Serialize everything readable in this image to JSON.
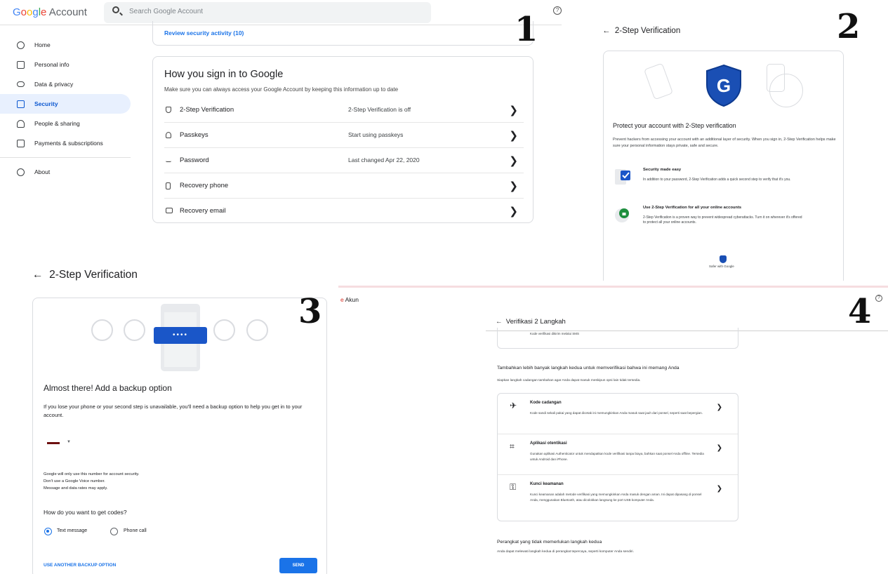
{
  "panel1": {
    "logo_google": "Google",
    "logo_account": "Account",
    "search_placeholder": "Search Google Account",
    "nav": [
      {
        "label": "Home",
        "icon": "home-icon"
      },
      {
        "label": "Personal info",
        "icon": "id-card-icon"
      },
      {
        "label": "Data & privacy",
        "icon": "toggle-icon"
      },
      {
        "label": "Security",
        "icon": "lock-icon",
        "active": true
      },
      {
        "label": "People & sharing",
        "icon": "people-icon"
      },
      {
        "label": "Payments & subscriptions",
        "icon": "card-icon"
      },
      {
        "label": "About",
        "icon": "info-icon"
      }
    ],
    "review_link": "Review security activity (10)",
    "signin_title": "How you sign in to Google",
    "signin_subtitle": "Make sure you can always access your Google Account by keeping this information up to date",
    "rows": [
      {
        "label": "2-Step Verification",
        "value": "2-Step Verification is off"
      },
      {
        "label": "Passkeys",
        "value": "Start using passkeys"
      },
      {
        "label": "Password",
        "value": "Last changed Apr 22, 2020"
      },
      {
        "label": "Recovery phone",
        "value": ""
      },
      {
        "label": "Recovery email",
        "value": ""
      }
    ],
    "number": "1"
  },
  "panel2": {
    "title": "2-Step Verification",
    "heading": "Protect your account with 2-Step verification",
    "paragraph": "Prevent hackers from accessing your account with an additional layer of security. When you sign in, 2-Step Verification helps make sure your personal information stays private, safe and secure.",
    "feature1_title": "Security made easy",
    "feature1_desc": "In addition to your password, 2-Step Verification adds a quick second step to verify that it's you.",
    "feature2_title": "Use 2-Step Verification for all your online accounts",
    "feature2_desc": "2-Step Verification is a proven way to prevent widespread cyberattacks. Turn it on wherever it's offered to protect all your online accounts.",
    "safer": "Safer with Google",
    "number": "2"
  },
  "panel3": {
    "title": "2-Step Verification",
    "pin_mask": "••••",
    "heading": "Almost there! Add a backup option",
    "paragraph": "If you lose your phone or your second step is unavailable, you'll need a backup option to help you get in to your account.",
    "note1": "Google will only use this number for account security.",
    "note2": "Don't use a Google Voice number.",
    "note3": "Message and data rates may apply.",
    "question": "How do you want to get codes?",
    "option_text": "Text message",
    "option_call": "Phone call",
    "another": "USE ANOTHER BACKUP OPTION",
    "send": "SEND",
    "number": "3"
  },
  "panel4": {
    "akun": "Akun",
    "title": "Verifikasi 2 Langkah",
    "snippet": "Kode verifikasi dikirim melalui SMS",
    "heading": "Tambahkan lebih banyak langkah kedua untuk memverifikasi bahwa ini memang Anda",
    "subheading": "Siapkan langkah cadangan tambahan agar Anda dapat masuk meskipun opsi lain tidak tersedia.",
    "options": [
      {
        "title": "Kode cadangan",
        "desc": "Kode sandi sekali pakai yang dapat dicetak ini memungkinkan Anda masuk saat jauh dari ponsel, seperti saat bepergian.",
        "icon": "airplane-icon"
      },
      {
        "title": "Aplikasi otentikasi",
        "desc": "Gunakan aplikasi Authenticator untuk mendapatkan kode verifikasi tanpa biaya, bahkan saat ponsel Anda offline. Tersedia untuk Android dan iPhone.",
        "icon": "qr-code-icon"
      },
      {
        "title": "Kunci keamanan",
        "desc": "Kunci keamanan adalah metode verifikasi yang memungkinkan Anda masuk dengan aman. Ini dapat dipasang di ponsel Anda, menggunakan Bluetooth, atau dicolokkan langsung ke port USB komputer Anda.",
        "icon": "key-icon"
      }
    ],
    "heading2": "Perangkat yang tidak memerlukan langkah kedua",
    "subheading2": "Anda dapat melewati langkah kedua di perangkat tepercaya, seperti komputer Anda sendiri.",
    "number": "4"
  },
  "colors": {
    "accent": "#1a73e8",
    "shield": "#1a4fb4",
    "active_bg": "#e8f0fe"
  }
}
